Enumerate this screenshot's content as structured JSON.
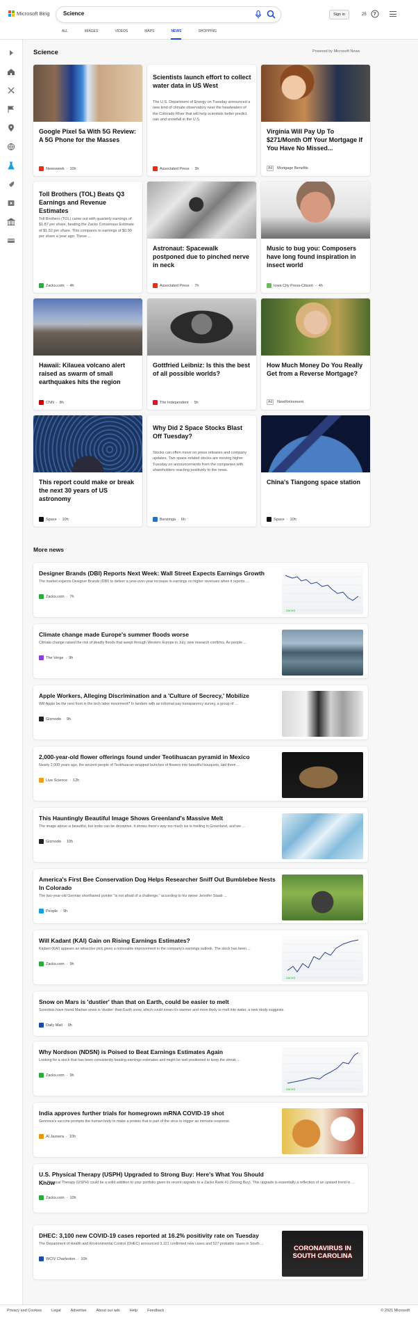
{
  "brand": {
    "name": "Microsoft Bing",
    "colors": [
      "#f25022",
      "#7fba00",
      "#00a4ef",
      "#ffb900"
    ]
  },
  "search": {
    "value": "Science"
  },
  "header": {
    "signin_label": "Sign in",
    "reward_count": "25"
  },
  "tabs": [
    {
      "label": "ALL"
    },
    {
      "label": "IMAGES"
    },
    {
      "label": "VIDEOS"
    },
    {
      "label": "MAPS"
    },
    {
      "label": "NEWS",
      "active": true
    },
    {
      "label": "SHOPPING"
    }
  ],
  "sidebar": {
    "icons": [
      "expand-icon",
      "home-icon",
      "sports-icon",
      "flag-icon",
      "location-icon",
      "world-icon",
      "science-icon",
      "rocket-icon",
      "entertainment-icon",
      "building-icon",
      "money-icon"
    ]
  },
  "section": {
    "title": "Science",
    "powered_by": "Powered by Microsoft News"
  },
  "cards": [
    {
      "title": "Google Pixel 5a With 5G Review: A 5G Phone for the Masses",
      "snippet": "",
      "source": "Newsweek",
      "time": "10h",
      "ad": false,
      "source_color": "#e0301e",
      "image": "phone"
    },
    {
      "title": "Scientists launch effort to collect water data in US West",
      "snippet": "The U.S. Department of Energy on Tuesday announced a new kind of climate observatory near the headwaters of the Colorado River that will help scientists better predict rain and snowfall in the U.S.",
      "source": "Associated Press",
      "time": "3h",
      "ad": false,
      "source_color": "#e0301e",
      "image": ""
    },
    {
      "title": "Virginia Will Pay Up To $271/Month Off Your Mortgage If You Have No Missed...",
      "snippet": "",
      "source": "Mortgage Benefits",
      "time": "",
      "ad": true,
      "ad_label": "Ad",
      "source_color": "",
      "image": "people"
    },
    {
      "title": "Toll Brothers (TOL) Beats Q3 Earnings and Revenue Estimates",
      "snippet": "Toll Brothers (TOL) came out with quarterly earnings of $1.87 per share, beating the Zacks Consensus Estimate of $1.52 per share. This compares to earnings of $0.90 per share a year ago. These ...",
      "source": "Zacks.com",
      "time": "4h",
      "ad": false,
      "source_color": "#2eaa3f",
      "image": ""
    },
    {
      "title": "Astronaut: Spacewalk postponed due to pinched nerve in neck",
      "snippet": "",
      "source": "Associated Press",
      "time": "7h",
      "ad": false,
      "source_color": "#e0301e",
      "image": "astronaut"
    },
    {
      "title": "Music to bug you: Composers have long found inspiration in insect world",
      "snippet": "",
      "source": "Iowa City Press-Citizen",
      "time": "4h",
      "ad": false,
      "source_color": "#6fb85a",
      "image": "man"
    },
    {
      "title": "Hawaii: Kilauea volcano alert raised as swarm of small earthquakes hits the region",
      "snippet": "",
      "source": "CNN",
      "time": "8h",
      "ad": false,
      "source_color": "#cc0000",
      "image": "volcano"
    },
    {
      "title": "Gottfried Leibniz: Is this the best of all possible worlds?",
      "snippet": "",
      "source": "The Independent",
      "time": "5h",
      "ad": false,
      "source_color": "#d21a2c",
      "image": "portrait"
    },
    {
      "title": "How Much Money Do You Really Get from a Reverse Mortgage?",
      "snippet": "",
      "source": "NewRetirement",
      "time": "",
      "ad": true,
      "ad_label": "Ad",
      "source_color": "",
      "image": "woman"
    },
    {
      "title": "This report could make or break the next 30 years of US astronomy",
      "snippet": "",
      "source": "Space",
      "time": "10h",
      "ad": false,
      "source_color": "#111111",
      "image": "stars"
    },
    {
      "title": "Why Did 2 Space Stocks Blast Off Tuesday?",
      "snippet": "Stocks can often move on press releases and company updates. Two space-related stocks are moving higher Tuesday on announcements from the companies with shareholders reacting positively to the news.",
      "source": "Benzinga",
      "time": "6h",
      "ad": false,
      "source_color": "#1d73c9",
      "image": ""
    },
    {
      "title": "China's Tiangong space station",
      "snippet": "",
      "source": "Space",
      "time": "10h",
      "ad": false,
      "source_color": "#111111",
      "image": "station"
    }
  ],
  "more_news": {
    "title": "More news",
    "items": [
      {
        "title": "Designer Brands (DBI) Reports Next Week: Wall Street Expects Earnings Growth",
        "snippet": "The market expects Designer Brands (DBI) to deliver a year-over-year increase in earnings on higher revenues when it reports ...",
        "source": "Zacks.com",
        "time": "7h",
        "source_color": "#2eaa3f",
        "thumb": "chart"
      },
      {
        "title": "Climate change made Europe's summer floods worse",
        "snippet": "Climate change raised the risk of deadly floods that swept through Western Europe in July, new research confirms. As people ...",
        "source": "The Verge",
        "time": "9h",
        "source_color": "#8b3fd9",
        "thumb": "flood"
      },
      {
        "title": "Apple Workers, Alleging Discrimination and a 'Culture of Secrecy,' Mobilize",
        "snippet": "Will Apple be the next front in the tech labor movement? In tandem with an informal pay transparency survey, a group of ...",
        "source": "Gizmodo",
        "time": "9h",
        "source_color": "#222222",
        "thumb": "store"
      },
      {
        "title": "2,000-year-old flower offerings found under Teotihuacan pyramid in Mexico",
        "snippet": "Nearly 2,000 years ago, the ancient people of Teotihuacan wrapped bunches of flowers into beautiful bouquets, laid them ...",
        "source": "Live Science",
        "time": "12h",
        "source_color": "#e8a21f",
        "thumb": "flower"
      },
      {
        "title": "This Hauntingly Beautiful Image Shows Greenland's Massive Melt",
        "snippet": "The image above is beautiful, but looks can be deceptive. It shows there's way too much ice is melting in Greenland, and we ...",
        "source": "Gizmodo",
        "time": "10h",
        "source_color": "#222222",
        "thumb": "ice"
      },
      {
        "title": "America's First Bee Conservation Dog Helps Researcher Sniff Out Bumblebee Nests In Colorado",
        "snippet": "The two-year-old German shorthaired pointer \"is not afraid of a challenge,\" according to his owner Jennifer Staab ...",
        "source": "People",
        "time": "9h",
        "source_color": "#1aa1d8",
        "thumb": "dog"
      },
      {
        "title": "Will Kadant (KAI) Gain on Rising Earnings Estimates?",
        "snippet": "Kadant (KAI) appears an attractive pick given a noticeable improvement in the company's earnings outlook. The stock has been ...",
        "source": "Zacks.com",
        "time": "9h",
        "source_color": "#2eaa3f",
        "thumb": "chart2"
      },
      {
        "title": "Snow on Mars is 'dustier' than that on Earth, could be easier to melt",
        "snippet": "Scientists have found Martian snow is 'dustier' than Earth snow, which could mean it's warmer and more likely to melt into water, a new study suggests.",
        "source": "Daily Mail",
        "time": "9h",
        "source_color": "#1d4fa0",
        "thumb": ""
      },
      {
        "title": "Why Nordson (NDSN) is Poised to Beat Earnings Estimates Again",
        "snippet": "Looking for a stock that has been consistently beating earnings estimates and might be well positioned to keep the streak ...",
        "source": "Zacks.com",
        "time": "9h",
        "source_color": "#2eaa3f",
        "thumb": "chart3"
      },
      {
        "title": "India approves further trials for homegrown mRNA COVID-19 shot",
        "snippet": "Gennova's vaccine prompts the human body to make a protein that is part of the virus to trigger an immune response.",
        "source": "Al Jazeera",
        "time": "10h",
        "source_color": "#e29b12",
        "thumb": "vaccine"
      },
      {
        "title": "U.S. Physical Therapy (USPH) Upgraded to Strong Buy: Here's What You Should Know",
        "snippet": "U.S. Physical Therapy (USPH) could be a solid addition to your portfolio given its recent upgrade to a Zacks Rank #1 (Strong Buy). This upgrade is essentially a reflection of an upward trend in ...",
        "source": "Zacks.com",
        "time": "10h",
        "source_color": "#2eaa3f",
        "thumb": ""
      },
      {
        "title": "DHEC: 3,100 new COVID-19 cases reported at 16.2% positivity rate on Tuesday",
        "snippet": "The Department of Health and Environmental Control (DHEC) announced 3,121 confirmed new cases and 527 probable cases in South ...",
        "source": "WCIV Charleston",
        "time": "10h",
        "source_color": "#1d4fa0",
        "thumb": "covid",
        "thumb_text": "CORONAVIRUS IN SOUTH CAROLINA"
      }
    ]
  },
  "footer": {
    "links": [
      "Privacy and Cookies",
      "Legal",
      "Advertise",
      "About our ads",
      "Help",
      "Feedback"
    ],
    "copyright": "© 2021 Microsoft"
  }
}
